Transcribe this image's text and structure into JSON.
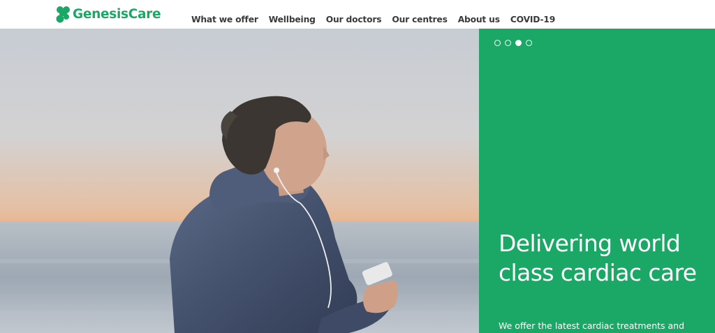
{
  "brand": {
    "name": "GenesisCare",
    "logo_icon": "genesiscare-logo-icon",
    "brand_color": "#1ba866"
  },
  "nav": {
    "items": [
      {
        "label": "What we offer"
      },
      {
        "label": "Wellbeing"
      },
      {
        "label": "Our doctors"
      },
      {
        "label": "Our centres"
      },
      {
        "label": "About us"
      },
      {
        "label": "COVID-19"
      }
    ]
  },
  "hero": {
    "image": "woman-running-on-beach-photo",
    "headline": "Delivering world class cardiac care",
    "subtext": "We offer the latest cardiac treatments and",
    "panel_color": "#1ba866",
    "carousel": {
      "total": 4,
      "active_index": 3
    }
  }
}
